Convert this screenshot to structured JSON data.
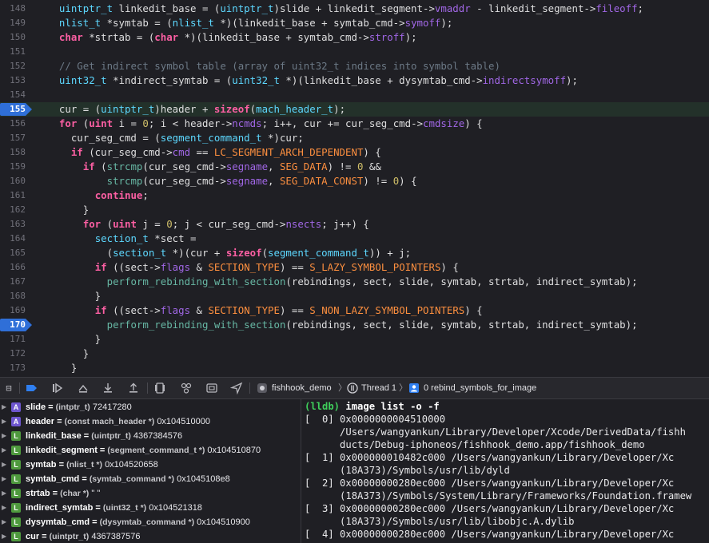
{
  "editor": {
    "current_line": "155",
    "breakpoint_line": "170",
    "lines": [
      {
        "n": "148",
        "segs": [
          [
            "",
            "  "
          ],
          [
            "t",
            "uintptr_t"
          ],
          [
            "",
            " linkedit_base = ("
          ],
          [
            "t",
            "uintptr_t"
          ],
          [
            "",
            ")slide + linkedit_segment->"
          ],
          [
            "m",
            "vmaddr"
          ],
          [
            "",
            " - linkedit_segment->"
          ],
          [
            "m",
            "fileoff"
          ],
          [
            "",
            ";"
          ]
        ]
      },
      {
        "n": "149",
        "segs": [
          [
            "",
            "  "
          ],
          [
            "t",
            "nlist_t"
          ],
          [
            "",
            " *symtab = ("
          ],
          [
            "t",
            "nlist_t"
          ],
          [
            "",
            " *)(linkedit_base + symtab_cmd->"
          ],
          [
            "m",
            "symoff"
          ],
          [
            "",
            ");"
          ]
        ]
      },
      {
        "n": "150",
        "segs": [
          [
            "",
            "  "
          ],
          [
            "k",
            "char"
          ],
          [
            "",
            " *strtab = ("
          ],
          [
            "k",
            "char"
          ],
          [
            "",
            " *)(linkedit_base + symtab_cmd->"
          ],
          [
            "m",
            "stroff"
          ],
          [
            "",
            ");"
          ]
        ]
      },
      {
        "n": "151",
        "segs": []
      },
      {
        "n": "152",
        "segs": [
          [
            "",
            "  "
          ],
          [
            "c",
            "// Get indirect symbol table (array of uint32_t indices into symbol table)"
          ]
        ]
      },
      {
        "n": "153",
        "segs": [
          [
            "",
            "  "
          ],
          [
            "t",
            "uint32_t"
          ],
          [
            "",
            " *indirect_symtab = ("
          ],
          [
            "t",
            "uint32_t"
          ],
          [
            "",
            " *)(linkedit_base + dysymtab_cmd->"
          ],
          [
            "m",
            "indirectsymoff"
          ],
          [
            "",
            ");"
          ]
        ]
      },
      {
        "n": "154",
        "segs": []
      },
      {
        "n": "155",
        "segs": [
          [
            "",
            "  cur = ("
          ],
          [
            "t",
            "uintptr_t"
          ],
          [
            "",
            ")header + "
          ],
          [
            "k",
            "sizeof"
          ],
          [
            "",
            "("
          ],
          [
            "t",
            "mach_header_t"
          ],
          [
            "",
            ");"
          ]
        ]
      },
      {
        "n": "156",
        "segs": [
          [
            "",
            "  "
          ],
          [
            "k",
            "for"
          ],
          [
            "",
            " ("
          ],
          [
            "k",
            "uint"
          ],
          [
            "",
            " i = "
          ],
          [
            "n",
            "0"
          ],
          [
            "",
            "; i < header->"
          ],
          [
            "m",
            "ncmds"
          ],
          [
            "",
            "; i++, cur += cur_seg_cmd->"
          ],
          [
            "m",
            "cmdsize"
          ],
          [
            "",
            ") {"
          ]
        ]
      },
      {
        "n": "157",
        "segs": [
          [
            "",
            "    cur_seg_cmd = ("
          ],
          [
            "t",
            "segment_command_t"
          ],
          [
            "",
            " *)cur;"
          ]
        ]
      },
      {
        "n": "158",
        "segs": [
          [
            "",
            "    "
          ],
          [
            "k",
            "if"
          ],
          [
            "",
            " (cur_seg_cmd->"
          ],
          [
            "m",
            "cmd"
          ],
          [
            "",
            " == "
          ],
          [
            "mac",
            "LC_SEGMENT_ARCH_DEPENDENT"
          ],
          [
            "",
            ") {"
          ]
        ]
      },
      {
        "n": "159",
        "segs": [
          [
            "",
            "      "
          ],
          [
            "k",
            "if"
          ],
          [
            "",
            " ("
          ],
          [
            "f",
            "strcmp"
          ],
          [
            "",
            "(cur_seg_cmd->"
          ],
          [
            "m",
            "segname"
          ],
          [
            "",
            ", "
          ],
          [
            "mac",
            "SEG_DATA"
          ],
          [
            "",
            ") != "
          ],
          [
            "n",
            "0"
          ],
          [
            "",
            " &&"
          ]
        ]
      },
      {
        "n": "160",
        "segs": [
          [
            "",
            "          "
          ],
          [
            "f",
            "strcmp"
          ],
          [
            "",
            "(cur_seg_cmd->"
          ],
          [
            "m",
            "segname"
          ],
          [
            "",
            ", "
          ],
          [
            "mac",
            "SEG_DATA_CONST"
          ],
          [
            "",
            ") != "
          ],
          [
            "n",
            "0"
          ],
          [
            "",
            ") {"
          ]
        ]
      },
      {
        "n": "161",
        "segs": [
          [
            "",
            "        "
          ],
          [
            "k",
            "continue"
          ],
          [
            "",
            ";"
          ]
        ]
      },
      {
        "n": "162",
        "segs": [
          [
            "",
            "      }"
          ]
        ]
      },
      {
        "n": "163",
        "segs": [
          [
            "",
            "      "
          ],
          [
            "k",
            "for"
          ],
          [
            "",
            " ("
          ],
          [
            "k",
            "uint"
          ],
          [
            "",
            " j = "
          ],
          [
            "n",
            "0"
          ],
          [
            "",
            "; j < cur_seg_cmd->"
          ],
          [
            "m",
            "nsects"
          ],
          [
            "",
            "; j++) {"
          ]
        ]
      },
      {
        "n": "164",
        "segs": [
          [
            "",
            "        "
          ],
          [
            "t",
            "section_t"
          ],
          [
            "",
            " *sect ="
          ]
        ]
      },
      {
        "n": "165",
        "segs": [
          [
            "",
            "          ("
          ],
          [
            "t",
            "section_t"
          ],
          [
            "",
            " *)(cur + "
          ],
          [
            "k",
            "sizeof"
          ],
          [
            "",
            "("
          ],
          [
            "t",
            "segment_command_t"
          ],
          [
            "",
            ")) + j;"
          ]
        ]
      },
      {
        "n": "166",
        "segs": [
          [
            "",
            "        "
          ],
          [
            "k",
            "if"
          ],
          [
            "",
            " ((sect->"
          ],
          [
            "m",
            "flags"
          ],
          [
            "",
            " & "
          ],
          [
            "mac",
            "SECTION_TYPE"
          ],
          [
            "",
            ") == "
          ],
          [
            "mac",
            "S_LAZY_SYMBOL_POINTERS"
          ],
          [
            "",
            ") {"
          ]
        ]
      },
      {
        "n": "167",
        "segs": [
          [
            "",
            "          "
          ],
          [
            "f",
            "perform_rebinding_with_section"
          ],
          [
            "",
            "(rebindings, sect, slide, symtab, strtab, indirect_symtab);"
          ]
        ]
      },
      {
        "n": "168",
        "segs": [
          [
            "",
            "        }"
          ]
        ]
      },
      {
        "n": "169",
        "segs": [
          [
            "",
            "        "
          ],
          [
            "k",
            "if"
          ],
          [
            "",
            " ((sect->"
          ],
          [
            "m",
            "flags"
          ],
          [
            "",
            " & "
          ],
          [
            "mac",
            "SECTION_TYPE"
          ],
          [
            "",
            ") == "
          ],
          [
            "mac",
            "S_NON_LAZY_SYMBOL_POINTERS"
          ],
          [
            "",
            ") {"
          ]
        ]
      },
      {
        "n": "170",
        "segs": [
          [
            "",
            "          "
          ],
          [
            "f",
            "perform_rebinding_with_section"
          ],
          [
            "",
            "(rebindings, sect, slide, symtab, strtab, indirect_symtab);"
          ]
        ]
      },
      {
        "n": "171",
        "segs": [
          [
            "",
            "        }"
          ]
        ]
      },
      {
        "n": "172",
        "segs": [
          [
            "",
            "      }"
          ]
        ]
      },
      {
        "n": "173",
        "segs": [
          [
            "",
            "    }"
          ]
        ]
      },
      {
        "n": "",
        "segs": [
          [
            "",
            "  }"
          ]
        ]
      }
    ]
  },
  "debug_bar": {
    "icons": [
      "hide-debug-area-icon",
      "breakpoints-toggle-icon",
      "continue-icon",
      "step-over-icon",
      "step-into-icon",
      "step-out-icon",
      "view-hierarchy-icon",
      "memory-graph-icon",
      "environment-overrides-icon",
      "simulate-location-icon"
    ],
    "breadcrumb": {
      "target": "fishhook_demo",
      "thread": "Thread 1",
      "frame": "0 rebind_symbols_for_image"
    }
  },
  "variables": [
    {
      "badge": "A",
      "name": "slide",
      "type": "(intptr_t)",
      "value": "72417280"
    },
    {
      "badge": "A",
      "name": "header",
      "type": "(const mach_header *)",
      "value": "0x104510000"
    },
    {
      "badge": "L",
      "name": "linkedit_base",
      "type": "(uintptr_t)",
      "value": "4367384576"
    },
    {
      "badge": "L",
      "name": "linkedit_segment",
      "type": "(segment_command_t *)",
      "value": "0x104510870"
    },
    {
      "badge": "L",
      "name": "symtab",
      "type": "(nlist_t *)",
      "value": "0x104520658"
    },
    {
      "badge": "L",
      "name": "symtab_cmd",
      "type": "(symtab_command *)",
      "value": "0x1045108e8"
    },
    {
      "badge": "L",
      "name": "strtab",
      "type": "(char *)",
      "value": "\" \""
    },
    {
      "badge": "L",
      "name": "indirect_symtab",
      "type": "(uint32_t *)",
      "value": "0x104521318"
    },
    {
      "badge": "L",
      "name": "dysymtab_cmd",
      "type": "(dysymtab_command *)",
      "value": "0x104510900"
    },
    {
      "badge": "L",
      "name": "cur",
      "type": "(uintptr_t)",
      "value": "4367387576"
    }
  ],
  "console": {
    "prompt": "(lldb)",
    "command": "image list -o -f",
    "lines": [
      "[  0] 0x0000000004510000",
      "      /Users/wangyankun/Library/Developer/Xcode/DerivedData/fishh",
      "      ducts/Debug-iphoneos/fishhook_demo.app/fishhook_demo",
      "[  1] 0x000000010482c000 /Users/wangyankun/Library/Developer/Xc",
      "      (18A373)/Symbols/usr/lib/dyld",
      "[  2] 0x00000000280ec000 /Users/wangyankun/Library/Developer/Xc",
      "      (18A373)/Symbols/System/Library/Frameworks/Foundation.framew",
      "[  3] 0x00000000280ec000 /Users/wangyankun/Library/Developer/Xc",
      "      (18A373)/Symbols/usr/lib/libobjc.A.dylib",
      "[  4] 0x00000000280ec000 /Users/wangyankun/Library/Developer/Xc"
    ]
  }
}
